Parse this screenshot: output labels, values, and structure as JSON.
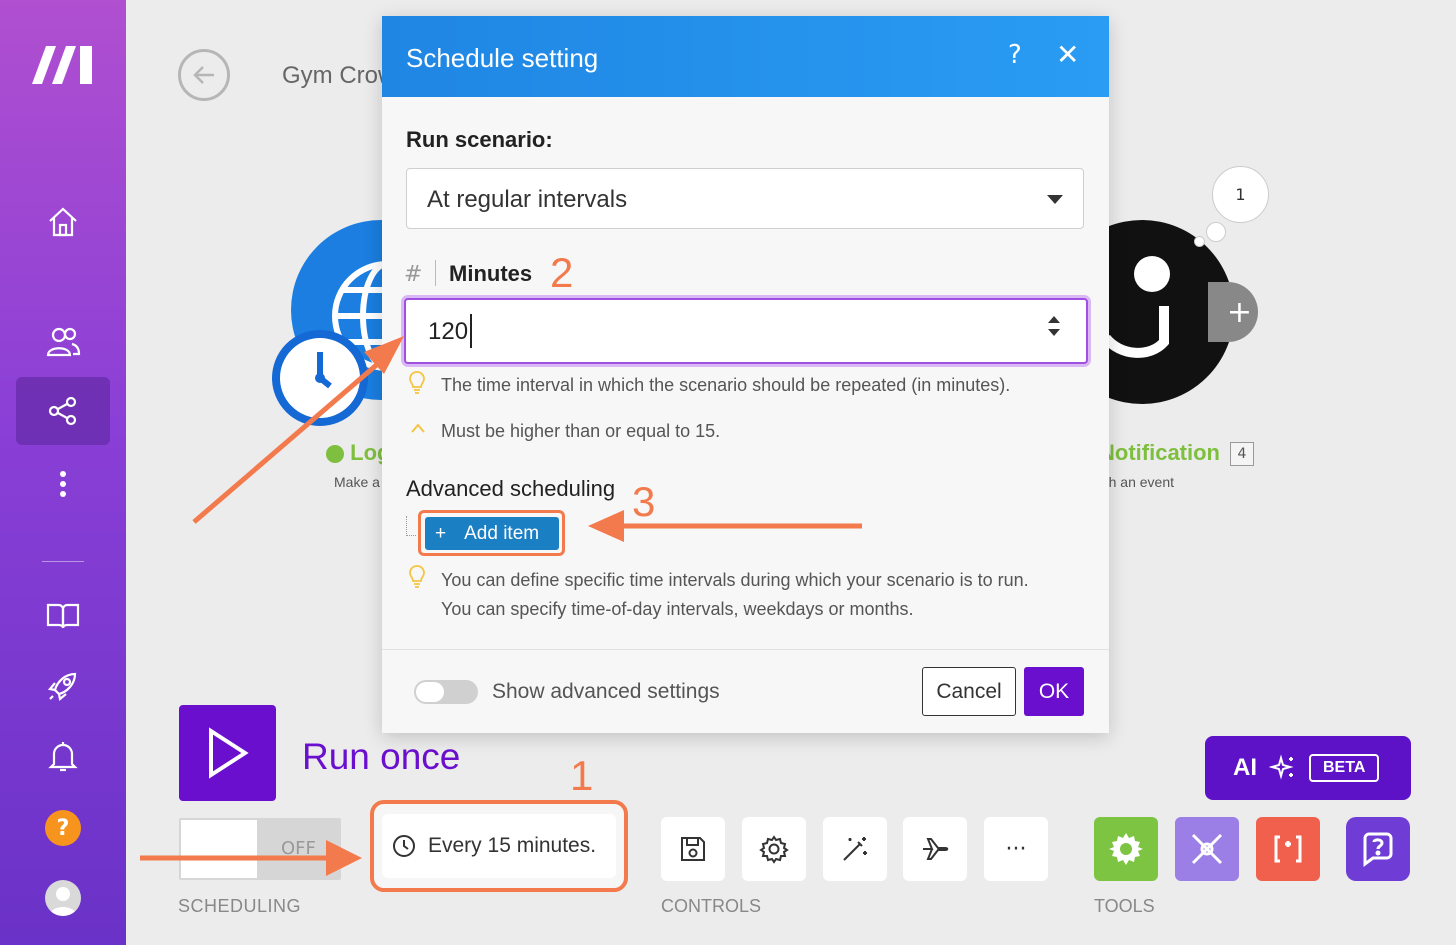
{
  "sidebar": {
    "items": [
      {
        "icon": "home-icon"
      },
      {
        "icon": "users-icon"
      },
      {
        "icon": "share-icon",
        "active": true
      },
      {
        "icon": "more-vertical-icon"
      },
      {
        "icon": "book-icon"
      },
      {
        "icon": "rocket-icon"
      },
      {
        "icon": "bell-icon"
      }
    ],
    "help_label": "?"
  },
  "header": {
    "title": "Gym Crow"
  },
  "canvas": {
    "left_module": {
      "label": "Log",
      "sub": "Make a",
      "color": "#1b7ee0"
    },
    "right_module": {
      "label": "Notification",
      "sub": "Watch an event",
      "count": "4",
      "bubble": "1"
    },
    "plus_label": "+"
  },
  "modal": {
    "title": "Schedule setting",
    "help": "?",
    "close": "✕",
    "run_label": "Run scenario:",
    "run_value": "At regular intervals",
    "minutes_hash": "#",
    "minutes_label": "Minutes",
    "minutes_value": "120",
    "hint_interval": "The time interval in which the scenario should be repeated (in minutes).",
    "hint_min": "Must be higher than or equal to 15.",
    "advanced_label": "Advanced scheduling",
    "add_plus": "+",
    "add_item": "Add item",
    "hint_define_1": "You can define specific time intervals during which your scenario is to run.",
    "hint_define_2": "You can specify time-of-day intervals, weekdays or months.",
    "show_advanced": "Show advanced settings",
    "cancel": "Cancel",
    "ok": "OK"
  },
  "toolbar": {
    "run_once": "Run once",
    "toggle_off": "OFF",
    "scheduling_caption": "SCHEDULING",
    "schedule_text": "Every 15 minutes.",
    "controls_caption": "CONTROLS",
    "more": "···",
    "tools_caption": "TOOLS",
    "ai": "AI",
    "beta": "BETA"
  },
  "annotations": {
    "n1": "1",
    "n2": "2",
    "n3": "3",
    "color": "#f27a4c"
  },
  "colors": {
    "brand_purple": "#6b0fcf",
    "header_blue": "#1f86e3",
    "tools_green": "#7dc443",
    "tools_lavender": "#9b7ee6",
    "tools_red": "#f0604c"
  }
}
